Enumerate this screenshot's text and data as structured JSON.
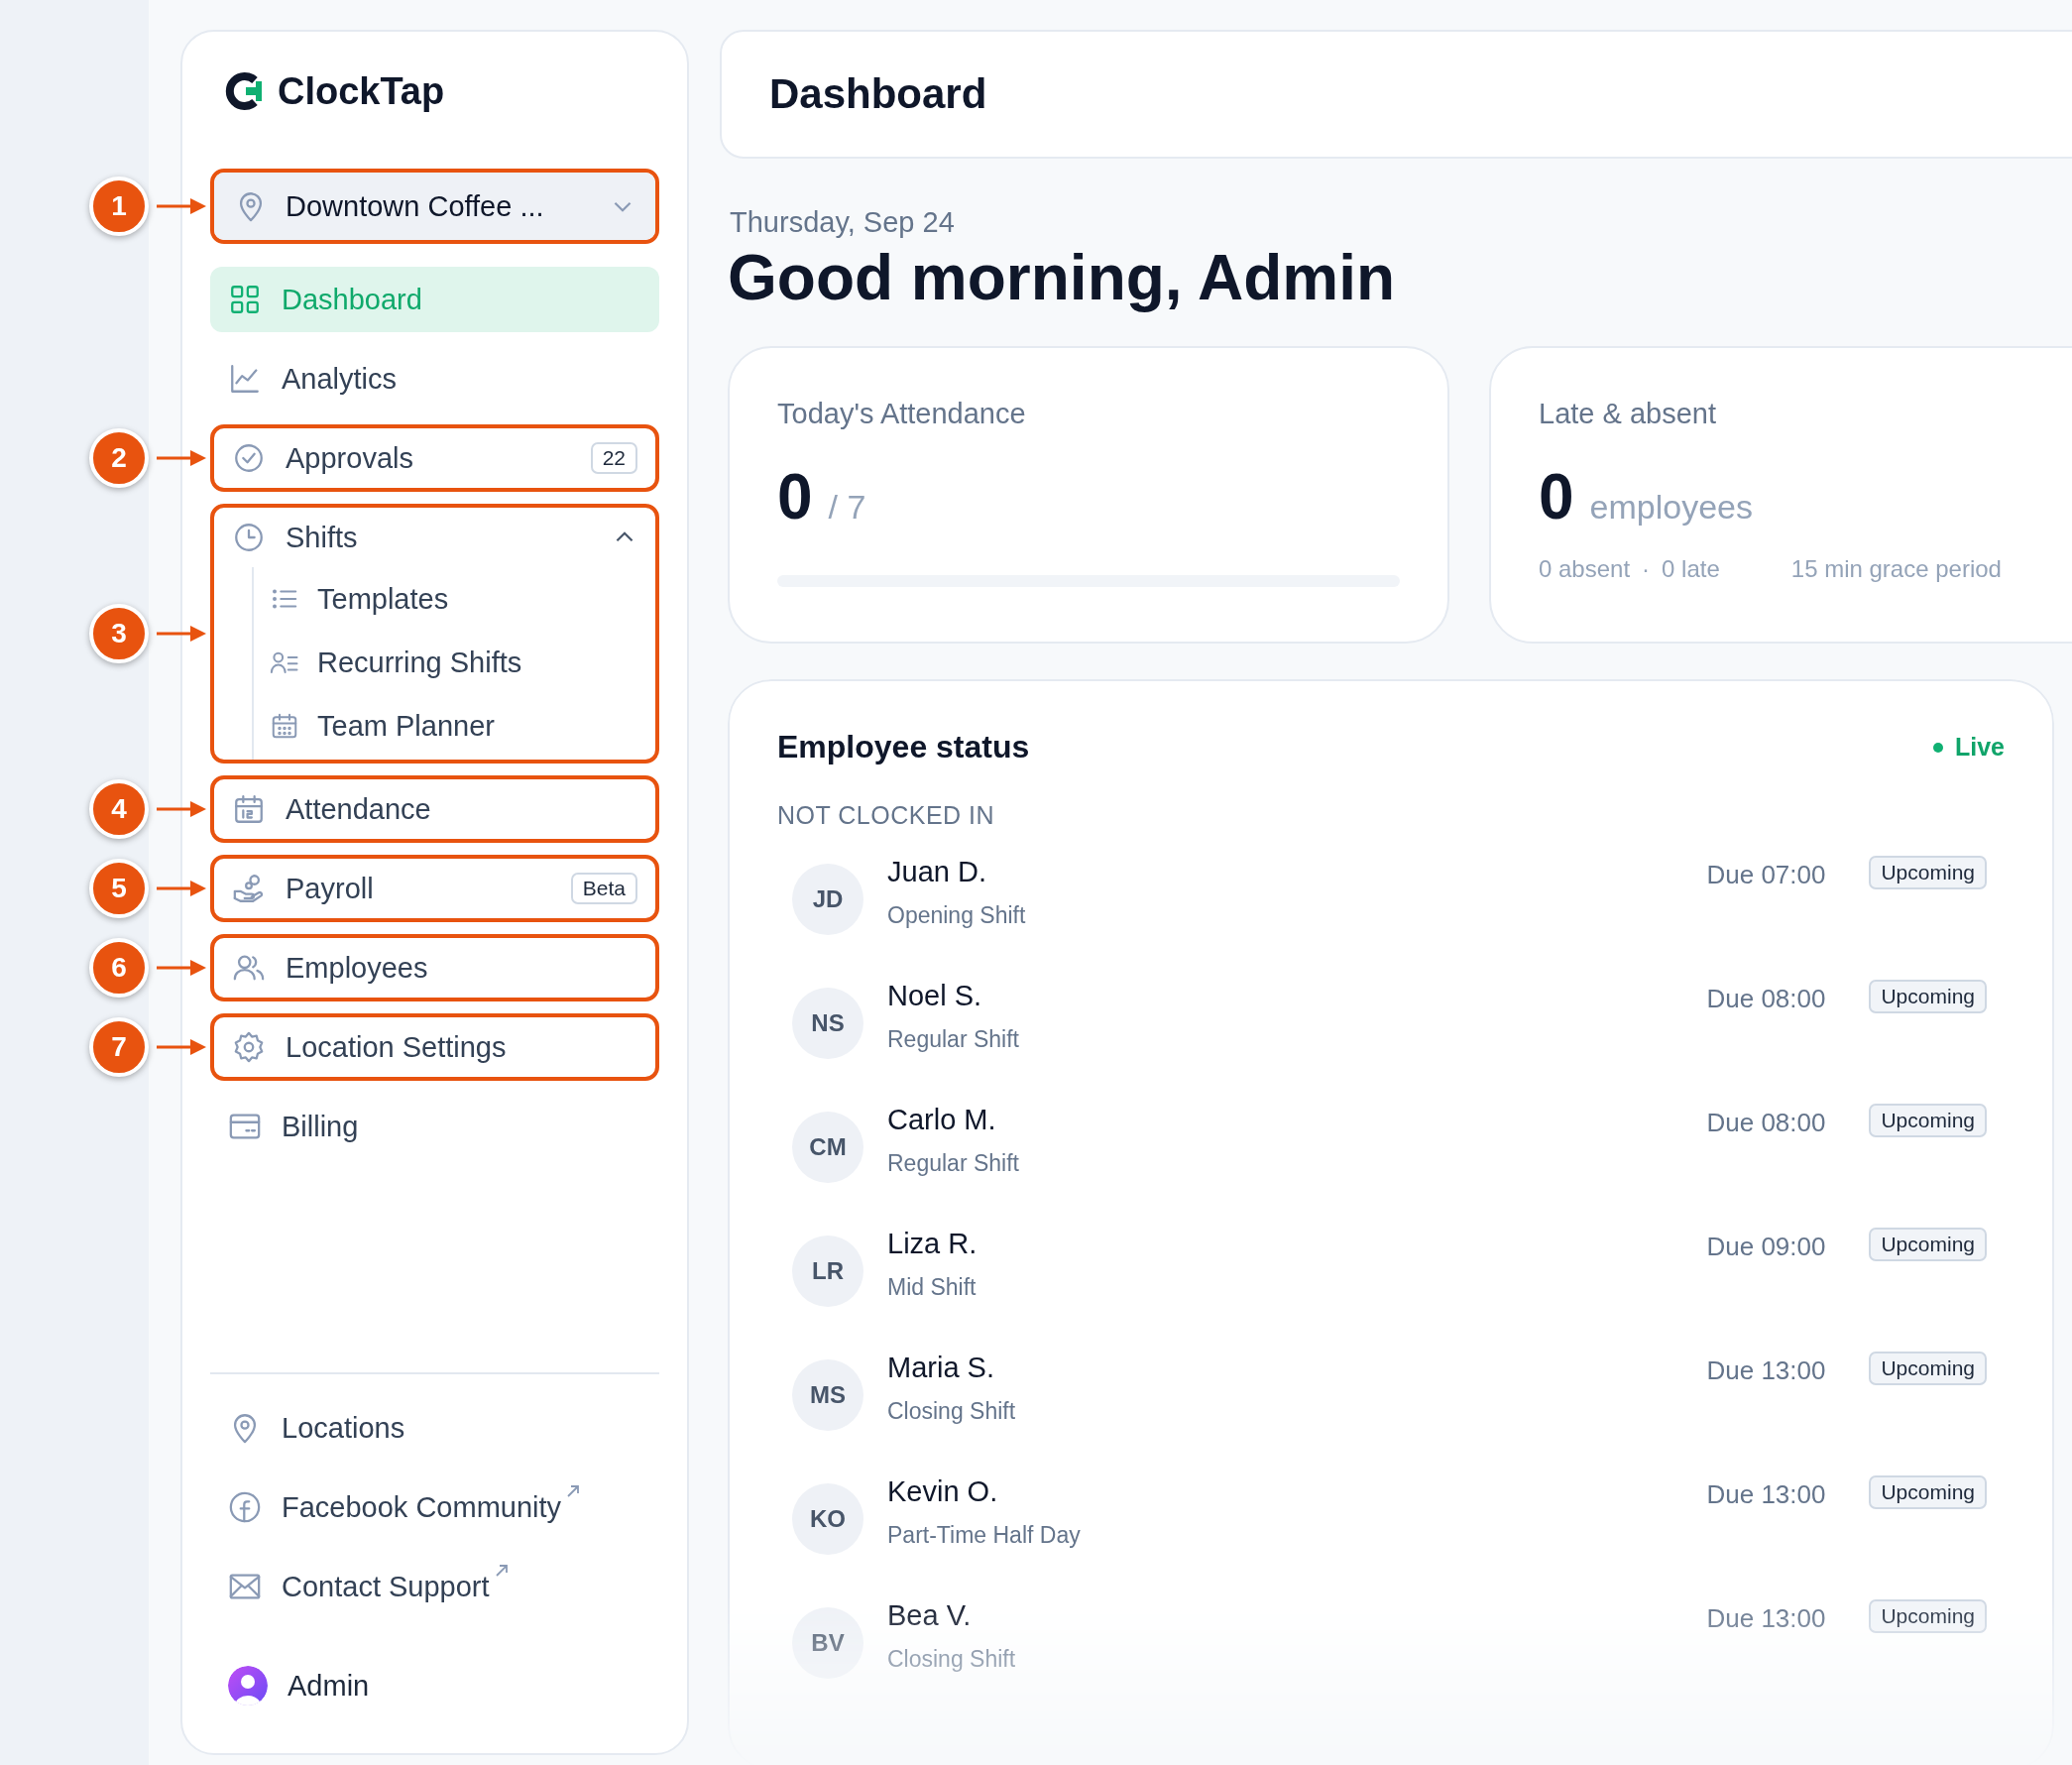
{
  "brand": {
    "name": "ClockTap"
  },
  "location_selector": {
    "value": "Downtown Coffee ...",
    "callout": "1"
  },
  "nav": [
    {
      "label": "Dashboard",
      "kind": "grid",
      "selected": true
    },
    {
      "label": "Analytics",
      "kind": "chart",
      "selected": false
    },
    {
      "label": "Approvals",
      "kind": "check",
      "selected": false,
      "badge": "22",
      "callout": "2"
    },
    {
      "label": "Shifts",
      "kind": "clock",
      "selected": false,
      "expanded": true,
      "callout": "3",
      "children": [
        {
          "label": "Templates",
          "kind": "list"
        },
        {
          "label": "Recurring Shifts",
          "kind": "roster"
        },
        {
          "label": "Team Planner",
          "kind": "calendar"
        }
      ]
    },
    {
      "label": "Attendance",
      "kind": "calendar12",
      "selected": false,
      "callout": "4"
    },
    {
      "label": "Payroll",
      "kind": "hand",
      "selected": false,
      "badge": "Beta",
      "callout": "5"
    },
    {
      "label": "Employees",
      "kind": "people",
      "selected": false,
      "callout": "6"
    },
    {
      "label": "Location Settings",
      "kind": "gear",
      "selected": false,
      "callout": "7"
    },
    {
      "label": "Billing",
      "kind": "card",
      "selected": false
    }
  ],
  "footer_links": [
    {
      "label": "Locations",
      "kind": "pin",
      "external": false
    },
    {
      "label": "Facebook Community",
      "kind": "facebook",
      "external": true
    },
    {
      "label": "Contact Support",
      "kind": "mail",
      "external": true
    },
    {
      "label": "Admin",
      "kind": "avatar",
      "external": false
    }
  ],
  "header": {
    "title": "Dashboard"
  },
  "date": "Thursday, Sep 24",
  "greeting": "Good morning, Admin",
  "attendance_card": {
    "title": "Today's Attendance",
    "value": "0",
    "total": "/ 7",
    "level": 0
  },
  "late_card": {
    "title": "Late & absent",
    "value": "0",
    "unit": "employees",
    "absent": "0 absent",
    "separator": "·",
    "late": "0 late",
    "grace": "15 min grace period"
  },
  "employee_status": {
    "title": "Employee status",
    "live": "Live",
    "section": "NOT CLOCKED IN",
    "employees": [
      {
        "initials": "JD",
        "name": "Juan D.",
        "shift": "Opening Shift",
        "due": "Due 07:00",
        "status": "Upcoming"
      },
      {
        "initials": "NS",
        "name": "Noel S.",
        "shift": "Regular Shift",
        "due": "Due 08:00",
        "status": "Upcoming"
      },
      {
        "initials": "CM",
        "name": "Carlo M.",
        "shift": "Regular Shift",
        "due": "Due 08:00",
        "status": "Upcoming"
      },
      {
        "initials": "LR",
        "name": "Liza R.",
        "shift": "Mid Shift",
        "due": "Due 09:00",
        "status": "Upcoming"
      },
      {
        "initials": "MS",
        "name": "Maria S.",
        "shift": "Closing Shift",
        "due": "Due 13:00",
        "status": "Upcoming"
      },
      {
        "initials": "KO",
        "name": "Kevin O.",
        "shift": "Part-Time Half Day",
        "due": "Due 13:00",
        "status": "Upcoming"
      },
      {
        "initials": "BV",
        "name": "Bea V.",
        "shift": "Closing Shift",
        "due": "Due 13:00",
        "status": "Upcoming"
      }
    ]
  }
}
